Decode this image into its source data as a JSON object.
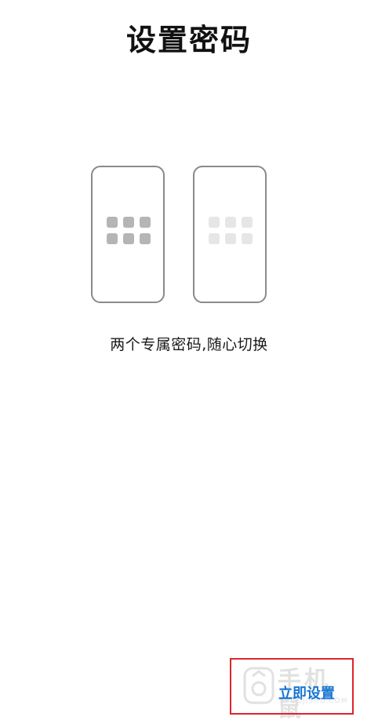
{
  "header": {
    "title": "设置密码"
  },
  "illustration": {
    "phones": [
      {
        "name": "primary",
        "grid_color": "#b5b5b5"
      },
      {
        "name": "secondary",
        "grid_color": "#e6e6e6"
      }
    ]
  },
  "caption": "两个专属密码,随心切换",
  "footer": {
    "cta_label": "立即设置",
    "cta_color": "#1976d2",
    "highlight_color": "#e0242b"
  },
  "watermark": {
    "text": "手机鼠",
    "sub": "SHOUJISHU.COM"
  }
}
